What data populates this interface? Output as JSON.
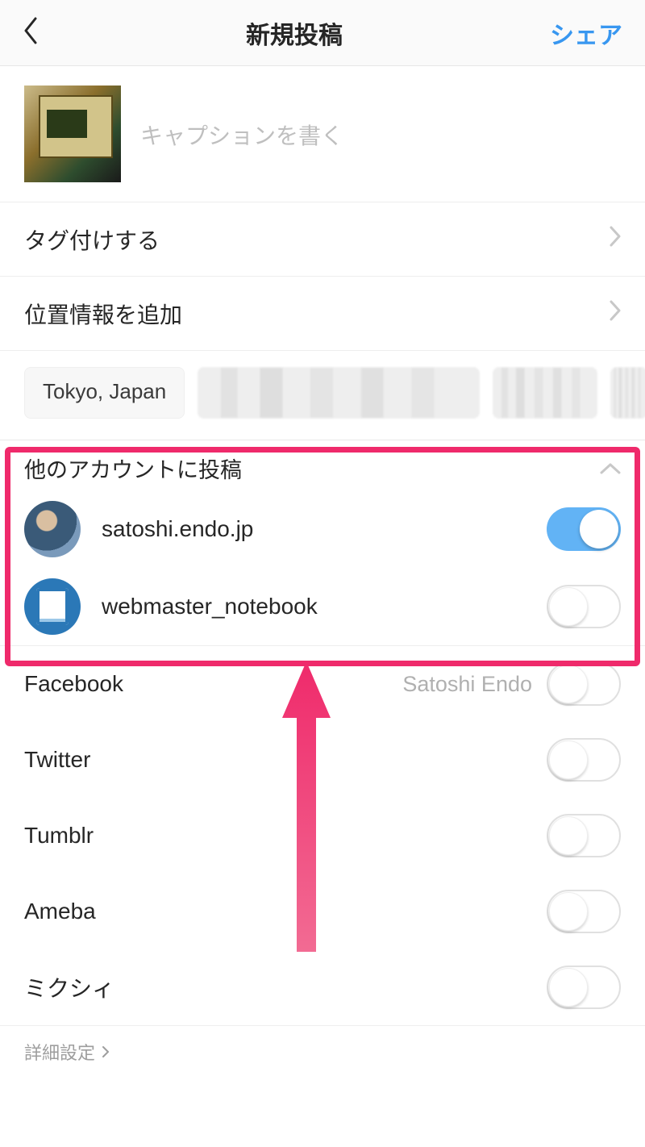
{
  "header": {
    "title": "新規投稿",
    "share": "シェア"
  },
  "caption": {
    "placeholder": "キャプションを書く"
  },
  "rows": {
    "tag": "タグ付けする",
    "location": "位置情報を追加"
  },
  "location_chips": {
    "tokyo": "Tokyo, Japan"
  },
  "other_accounts": {
    "heading": "他のアカウントに投稿",
    "items": [
      {
        "name": "satoshi.endo.jp",
        "on": true
      },
      {
        "name": "webmaster_notebook",
        "on": false
      }
    ]
  },
  "share_targets": [
    {
      "name": "Facebook",
      "extra": "Satoshi Endo",
      "on": false
    },
    {
      "name": "Twitter",
      "extra": "",
      "on": false
    },
    {
      "name": "Tumblr",
      "extra": "",
      "on": false
    },
    {
      "name": "Ameba",
      "extra": "",
      "on": false
    },
    {
      "name": "ミクシィ",
      "extra": "",
      "on": false
    }
  ],
  "advanced": "詳細設定"
}
